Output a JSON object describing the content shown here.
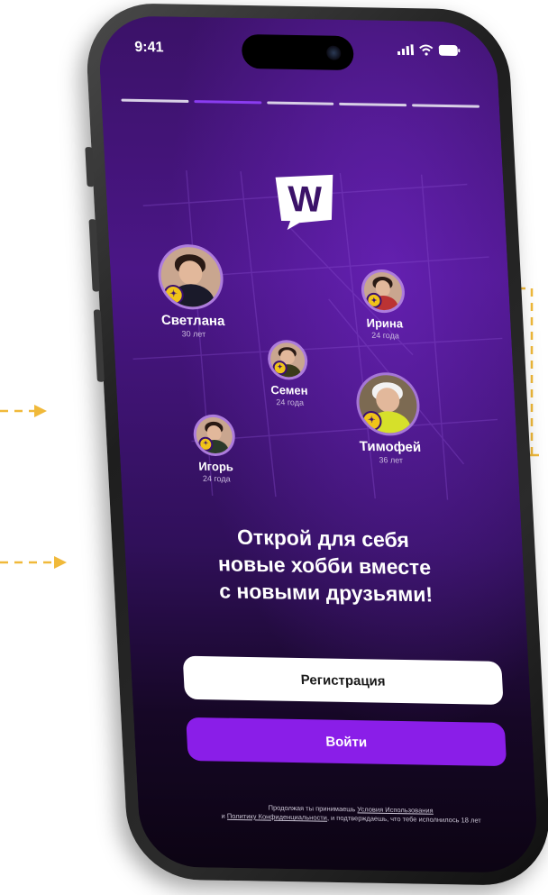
{
  "status_bar": {
    "time": "9:41",
    "icons": [
      "signal-icon",
      "wifi-icon",
      "battery-icon"
    ]
  },
  "onboarding_progress": {
    "total_steps": 5,
    "active_step": 2
  },
  "app_logo": "W",
  "people": [
    {
      "name": "Светлана",
      "age": "30 лет"
    },
    {
      "name": "Ирина",
      "age": "24 года"
    },
    {
      "name": "Семен",
      "age": "24 года"
    },
    {
      "name": "Тимофей",
      "age": "36 лет"
    },
    {
      "name": "Игорь",
      "age": "24 года"
    }
  ],
  "headline": {
    "line1": "Открой для себя",
    "line2": "новые хобби вместе",
    "line3": "с новыми друзьями!"
  },
  "buttons": {
    "register_label": "Регистрация",
    "login_label": "Войти"
  },
  "legal": {
    "prefix": "Продолжая ты принимаешь",
    "terms_link": "Условия Использования",
    "and": "и",
    "privacy_link": "Политику Конфиденциальности",
    "suffix": ", и подтверждаешь, что тебе исполнилось 18 лет"
  },
  "colors": {
    "accent": "#8a1ee8",
    "badge": "#f0c419",
    "background_dark": "#3b1268",
    "arrow": "#f0b93a"
  }
}
